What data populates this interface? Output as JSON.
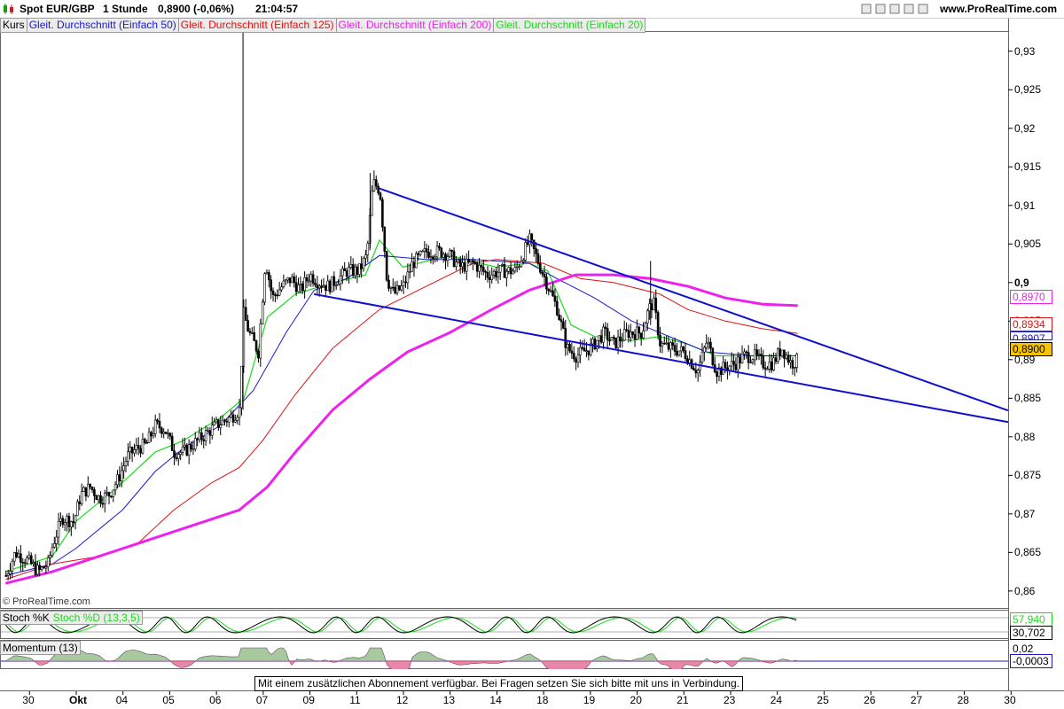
{
  "header": {
    "symbol": "Spot EUR/GBP",
    "timeframe": "1 Stunde",
    "price": "0,8900 (-0,06%)",
    "time": "21:04:57",
    "website": "www.ProRealTime.com",
    "icon": "candlestick-icon",
    "window_controls_icon": "window-controls-icon"
  },
  "legend": {
    "price_label": "Kurs",
    "ma50": "Gleit. Durchschnitt (Einfach 50)",
    "ma125": "Gleit. Durchschnitt (Einfach 125)",
    "ma200": "Gleit. Durchschnitt (Einfach 200)",
    "ma20": "Gleit. Durchschnitt (Einfach 20)"
  },
  "colors": {
    "ma50": "#1a1acc",
    "ma125": "#e01010",
    "ma200": "#ee22ee",
    "ma20": "#18dd18",
    "trendline": "#1010cc",
    "candle": "#000000",
    "last_price_bg": "#f5c400",
    "momentum_pos": "#a8c8a0",
    "momentum_neg": "#e888a8"
  },
  "tags": {
    "ma200": "0,8970",
    "ma125": "0,8934",
    "ma50": "0,8907",
    "last": "0,8900",
    "stoch_k": "57,940",
    "stoch_d": "30,702",
    "mom_top": "0,02",
    "mom_val": "-0,0003"
  },
  "stoch": {
    "title_k": "Stoch %K",
    "title_d": "Stoch %D (13,3,5)"
  },
  "momentum": {
    "title": "Momentum (13)"
  },
  "copyright": "© ProRealTime.com",
  "notice": "Mit einem zusätzlichen Abonnement verfügbar. Bei Fragen setzen Sie sich bitte mit uns in Verbindung.",
  "chart_data": {
    "type": "line",
    "title": "Spot EUR/GBP 1 Stunde",
    "y_ticks": [
      "0,93",
      "0,925",
      "0,92",
      "0,915",
      "0,91",
      "0,905",
      "0,9",
      "0,895",
      "0,89",
      "0,885",
      "0,88",
      "0,875",
      "0,87",
      "0,865",
      "0,86"
    ],
    "y_tick_values": [
      0.93,
      0.925,
      0.92,
      0.915,
      0.91,
      0.905,
      0.9,
      0.895,
      0.89,
      0.885,
      0.88,
      0.875,
      0.87,
      0.865,
      0.86
    ],
    "ylim": [
      0.8578,
      0.9325
    ],
    "x_ticks": [
      "30",
      "Okt",
      "04",
      "05",
      "06",
      "07",
      "09",
      "11",
      "12",
      "13",
      "14",
      "18",
      "19",
      "20",
      "21",
      "23",
      "24",
      "25",
      "26",
      "27",
      "28",
      "30"
    ],
    "x_tick_pos": [
      0,
      1,
      2,
      3,
      4,
      5,
      6,
      7,
      8,
      9,
      10,
      11,
      12,
      13,
      14,
      15,
      16,
      17,
      18,
      19,
      20,
      21
    ],
    "x_range": [
      -0.1,
      21.45
    ],
    "price_trace": [
      [
        0,
        0.862
      ],
      [
        0.2,
        0.865
      ],
      [
        0.45,
        0.864
      ],
      [
        0.7,
        0.8625
      ],
      [
        0.9,
        0.8635
      ],
      [
        1,
        0.866
      ],
      [
        1.2,
        0.8695
      ],
      [
        1.45,
        0.869
      ],
      [
        1.6,
        0.8725
      ],
      [
        1.8,
        0.8735
      ],
      [
        2.0,
        0.872
      ],
      [
        2.2,
        0.8725
      ],
      [
        2.4,
        0.8745
      ],
      [
        2.6,
        0.8775
      ],
      [
        2.8,
        0.8785
      ],
      [
        3.0,
        0.879
      ],
      [
        3.2,
        0.8815
      ],
      [
        3.4,
        0.881
      ],
      [
        3.6,
        0.878
      ],
      [
        3.8,
        0.878
      ],
      [
        4.0,
        0.879
      ],
      [
        4.2,
        0.88
      ],
      [
        4.5,
        0.8815
      ],
      [
        4.8,
        0.8825
      ],
      [
        5.0,
        0.8835
      ],
      [
        5.08,
        0.896
      ],
      [
        5.2,
        0.8935
      ],
      [
        5.4,
        0.891
      ],
      [
        5.55,
        0.903
      ],
      [
        5.7,
        0.898
      ],
      [
        5.9,
        0.8995
      ],
      [
        6.1,
        0.9005
      ],
      [
        6.3,
        0.899
      ],
      [
        6.5,
        0.901
      ],
      [
        6.7,
        0.9
      ],
      [
        6.9,
        0.8995
      ],
      [
        7.1,
        0.9005
      ],
      [
        7.3,
        0.9015
      ],
      [
        7.55,
        0.9015
      ],
      [
        7.72,
        0.9035
      ],
      [
        7.85,
        0.913
      ],
      [
        8.0,
        0.912
      ],
      [
        8.15,
        0.9005
      ],
      [
        8.3,
        0.8985
      ],
      [
        8.5,
        0.8995
      ],
      [
        8.7,
        0.9025
      ],
      [
        9.0,
        0.904
      ],
      [
        9.3,
        0.904
      ],
      [
        9.5,
        0.9035
      ],
      [
        9.7,
        0.902
      ],
      [
        10.0,
        0.9025
      ],
      [
        10.3,
        0.901
      ],
      [
        10.6,
        0.9015
      ],
      [
        10.9,
        0.9015
      ],
      [
        11.2,
        0.9055
      ],
      [
        11.4,
        0.9025
      ],
      [
        11.6,
        0.8995
      ],
      [
        11.8,
        0.8965
      ],
      [
        12.0,
        0.8915
      ],
      [
        12.2,
        0.8905
      ],
      [
        12.5,
        0.8915
      ],
      [
        12.8,
        0.8935
      ],
      [
        13.0,
        0.892
      ],
      [
        13.3,
        0.8935
      ],
      [
        13.6,
        0.8935
      ],
      [
        13.75,
        0.8965
      ],
      [
        13.85,
        0.8975
      ],
      [
        14.0,
        0.892
      ],
      [
        14.2,
        0.8915
      ],
      [
        14.5,
        0.891
      ],
      [
        14.8,
        0.8885
      ],
      [
        15.0,
        0.8925
      ],
      [
        15.2,
        0.8885
      ],
      [
        15.4,
        0.889
      ],
      [
        15.6,
        0.8895
      ],
      [
        15.8,
        0.8905
      ],
      [
        16.0,
        0.8905
      ],
      [
        16.2,
        0.8895
      ],
      [
        16.4,
        0.8895
      ],
      [
        16.6,
        0.8915
      ],
      [
        16.8,
        0.8895
      ],
      [
        16.95,
        0.89
      ]
    ],
    "series": [
      {
        "name": "Gleit. Durchschnitt (Einfach 20)",
        "values": [
          [
            0,
            0.8625
          ],
          [
            1,
            0.8645
          ],
          [
            1.5,
            0.869
          ],
          [
            2.4,
            0.8735
          ],
          [
            3.2,
            0.878
          ],
          [
            3.8,
            0.8795
          ],
          [
            4.6,
            0.8825
          ],
          [
            5.1,
            0.885
          ],
          [
            5.6,
            0.8955
          ],
          [
            6.2,
            0.8985
          ],
          [
            7.0,
            0.9
          ],
          [
            7.7,
            0.901
          ],
          [
            8.0,
            0.9055
          ],
          [
            8.5,
            0.902
          ],
          [
            9.5,
            0.9035
          ],
          [
            10.5,
            0.902
          ],
          [
            11.2,
            0.9025
          ],
          [
            11.6,
            0.9015
          ],
          [
            12.1,
            0.8945
          ],
          [
            12.6,
            0.893
          ],
          [
            13.4,
            0.8925
          ],
          [
            14.0,
            0.893
          ],
          [
            14.6,
            0.892
          ],
          [
            15.2,
            0.8905
          ],
          [
            16.0,
            0.8905
          ],
          [
            16.95,
            0.8905
          ]
        ]
      },
      {
        "name": "Gleit. Durchschnitt (Einfach 50)",
        "values": [
          [
            0,
            0.862
          ],
          [
            1,
            0.8635
          ],
          [
            1.5,
            0.8655
          ],
          [
            2.5,
            0.8705
          ],
          [
            3.2,
            0.8755
          ],
          [
            3.8,
            0.8785
          ],
          [
            4.6,
            0.8815
          ],
          [
            5.3,
            0.886
          ],
          [
            6.0,
            0.8935
          ],
          [
            6.6,
            0.899
          ],
          [
            7.3,
            0.9005
          ],
          [
            8.0,
            0.9035
          ],
          [
            9.0,
            0.903
          ],
          [
            10.0,
            0.903
          ],
          [
            11.2,
            0.9025
          ],
          [
            11.8,
            0.9005
          ],
          [
            12.6,
            0.898
          ],
          [
            13.4,
            0.895
          ],
          [
            14.2,
            0.893
          ],
          [
            15.0,
            0.891
          ],
          [
            16.0,
            0.8905
          ],
          [
            16.95,
            0.8905
          ]
        ]
      },
      {
        "name": "Gleit. Durchschnitt (Einfach 125)",
        "values": [
          [
            0,
            0.8615
          ],
          [
            1,
            0.8635
          ],
          [
            2,
            0.8645
          ],
          [
            2.8,
            0.866
          ],
          [
            3.6,
            0.8705
          ],
          [
            4.4,
            0.874
          ],
          [
            5.0,
            0.876
          ],
          [
            5.5,
            0.8795
          ],
          [
            6.2,
            0.8855
          ],
          [
            7.0,
            0.8915
          ],
          [
            8.0,
            0.8965
          ],
          [
            9.0,
            0.8995
          ],
          [
            10.0,
            0.9025
          ],
          [
            10.5,
            0.903
          ],
          [
            11.5,
            0.9025
          ],
          [
            12.3,
            0.9005
          ],
          [
            13.0,
            0.9
          ],
          [
            14.0,
            0.8985
          ],
          [
            14.6,
            0.8965
          ],
          [
            15.4,
            0.895
          ],
          [
            16.2,
            0.894
          ],
          [
            16.95,
            0.8934
          ]
        ]
      },
      {
        "name": "Gleit. Durchschnitt (Einfach 200)",
        "values": [
          [
            0,
            0.861
          ],
          [
            1,
            0.8625
          ],
          [
            2,
            0.8645
          ],
          [
            3,
            0.8665
          ],
          [
            4,
            0.8685
          ],
          [
            5,
            0.8705
          ],
          [
            5.6,
            0.8735
          ],
          [
            6.2,
            0.878
          ],
          [
            7.0,
            0.8835
          ],
          [
            7.8,
            0.8875
          ],
          [
            8.6,
            0.891
          ],
          [
            9.5,
            0.8935
          ],
          [
            10.4,
            0.8965
          ],
          [
            11.2,
            0.899
          ],
          [
            12.2,
            0.901
          ],
          [
            13.0,
            0.901
          ],
          [
            13.8,
            0.9005
          ],
          [
            14.6,
            0.8995
          ],
          [
            15.4,
            0.898
          ],
          [
            16.2,
            0.8972
          ],
          [
            16.95,
            0.897
          ]
        ]
      }
    ],
    "trendlines": [
      {
        "name": "upper",
        "from": [
          8.0,
          0.9122
        ],
        "to": [
          21.45,
          0.8834
        ]
      },
      {
        "name": "lower",
        "from": [
          6.6,
          0.8985
        ],
        "to": [
          21.45,
          0.8819
        ]
      }
    ]
  }
}
